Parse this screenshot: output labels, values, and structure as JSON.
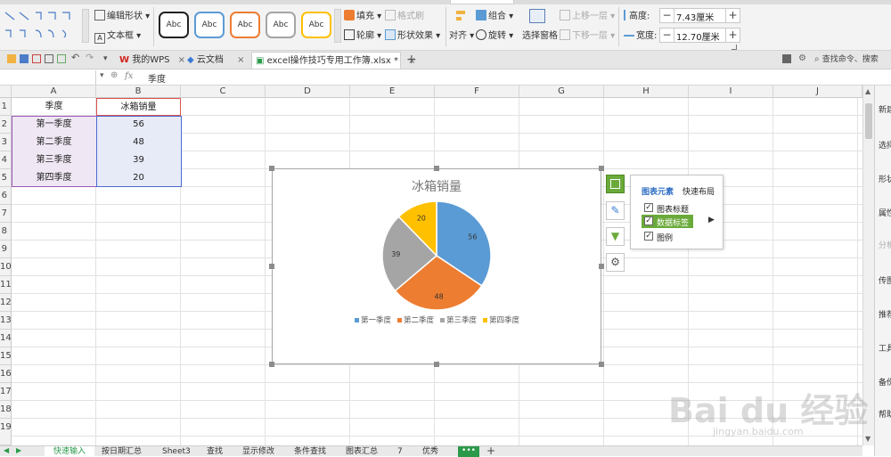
{
  "ribbon": {
    "edit_shape": "编辑形状",
    "text_box": "文本框",
    "shape_styles": [
      "Abc",
      "Abc",
      "Abc",
      "Abc",
      "Abc"
    ],
    "fill": "填充",
    "format_brush": "格式刷",
    "outline": "轮廓",
    "shape_effects": "形状效果",
    "align": "对齐",
    "group": "组合",
    "rotate": "旋转",
    "selection_pane": "选择窗格",
    "bring_forward": "上移一层",
    "send_backward": "下移一层",
    "height_label": "高度:",
    "height_value": "7.43厘米",
    "width_label": "宽度:",
    "width_value": "12.70厘米"
  },
  "tabs": {
    "my_wps": "我的WPS",
    "cloud_docs": "云文档",
    "active_doc": "excel操作技巧专用工作簿.xlsx *",
    "search": "查找命令、搜索"
  },
  "formula_bar": {
    "fx": "fx",
    "content": "季度"
  },
  "columns": [
    "A",
    "B",
    "C",
    "D",
    "E",
    "F",
    "G",
    "H",
    "I",
    "J"
  ],
  "rows": [
    "1",
    "2",
    "3",
    "4",
    "5",
    "6",
    "7",
    "8",
    "9",
    "10",
    "11",
    "12",
    "13",
    "14",
    "15",
    "16",
    "17",
    "18",
    "19"
  ],
  "table": {
    "headers": [
      "季度",
      "冰箱销量"
    ],
    "rows": [
      [
        "第一季度",
        "56"
      ],
      [
        "第二季度",
        "48"
      ],
      [
        "第三季度",
        "39"
      ],
      [
        "第四季度",
        "20"
      ]
    ]
  },
  "chart_panel": {
    "tab_elements": "图表元素",
    "tab_layout": "快速布局",
    "opt_title": "图表标题",
    "opt_data_labels": "数据标签",
    "opt_legend": "图例"
  },
  "sheet_tabs": [
    "快速输入",
    "按日期汇总",
    "Sheet3",
    "查找",
    "显示修改",
    "条件查找",
    "图表汇总",
    "7",
    "优秀"
  ],
  "right_panel": [
    "新建",
    "选择",
    "形状",
    "属性",
    "分析",
    "传图",
    "推荐",
    "工具",
    "备份",
    "帮助"
  ],
  "watermark": "Bai du 经验",
  "watermark_sub": "jingyan.baidu.com",
  "chart_data": {
    "type": "pie",
    "title": "冰箱销量",
    "categories": [
      "第一季度",
      "第二季度",
      "第三季度",
      "第四季度"
    ],
    "values": [
      56,
      48,
      39,
      20
    ],
    "colors": [
      "#5b9bd5",
      "#ed7d31",
      "#a5a5a5",
      "#ffc000"
    ],
    "legend": "bottom",
    "data_labels": true
  }
}
